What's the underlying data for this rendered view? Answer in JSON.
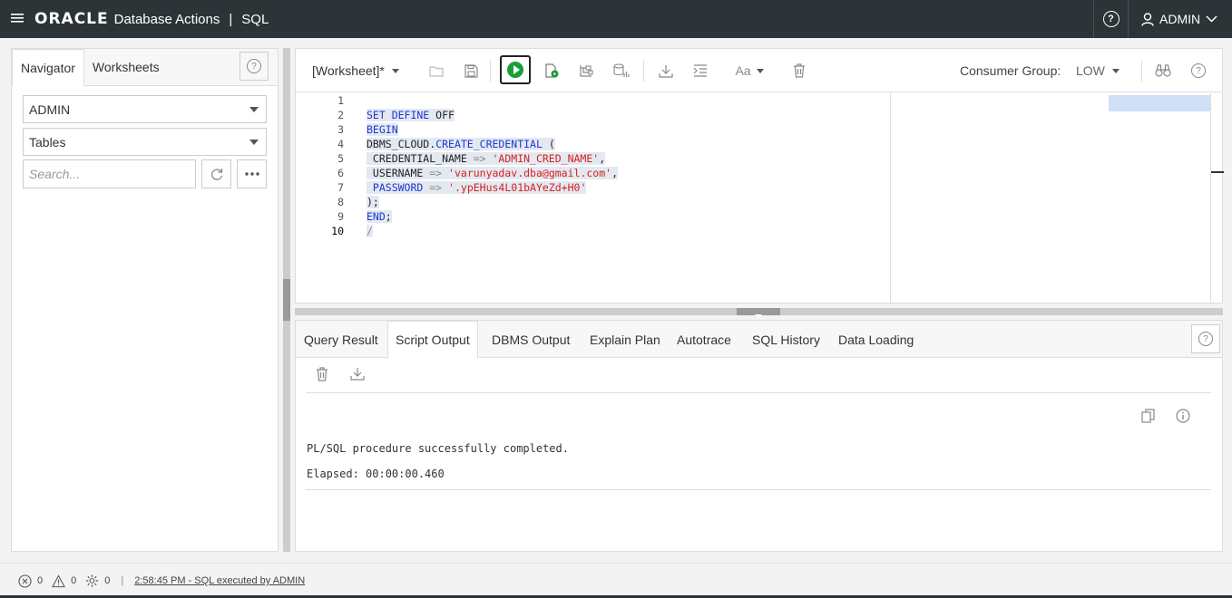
{
  "header": {
    "brand_logo": "ORACLE",
    "product": "Database Actions",
    "separator": "|",
    "section": "SQL",
    "user": "ADMIN"
  },
  "navigator": {
    "tabs": [
      "Navigator",
      "Worksheets"
    ],
    "active_tab": "Navigator",
    "schema_select": "ADMIN",
    "object_type_select": "Tables",
    "search_placeholder": "Search..."
  },
  "toolbar": {
    "worksheet_name": "[Worksheet]*",
    "consumer_group_label": "Consumer Group:",
    "consumer_group_value": "LOW"
  },
  "editor": {
    "line_numbers": [
      "1",
      "2",
      "3",
      "4",
      "5",
      "6",
      "7",
      "8",
      "9",
      "10"
    ],
    "lines": [
      [],
      [
        {
          "t": "SET DEFINE ",
          "c": "kw"
        },
        {
          "t": "OFF",
          "c": "plain"
        }
      ],
      [
        {
          "t": "BEGIN",
          "c": "kw"
        }
      ],
      [
        {
          "t": "DBMS_CLOUD",
          "c": "plain"
        },
        {
          "t": ".",
          "c": "plain"
        },
        {
          "t": "CREATE_CREDENTIAL",
          "c": "kw"
        },
        {
          "t": " (",
          "c": "plain"
        }
      ],
      [
        {
          "t": " CREDENTIAL_NAME ",
          "c": "plain"
        },
        {
          "t": "=>",
          "c": "op"
        },
        {
          "t": " ",
          "c": "plain"
        },
        {
          "t": "'ADMIN_CRED_NAME'",
          "c": "str"
        },
        {
          "t": ",",
          "c": "plain"
        }
      ],
      [
        {
          "t": " USERNAME ",
          "c": "plain"
        },
        {
          "t": "=>",
          "c": "op"
        },
        {
          "t": " ",
          "c": "plain"
        },
        {
          "t": "'varunyadav.dba@gmail.com'",
          "c": "str"
        },
        {
          "t": ",",
          "c": "plain"
        }
      ],
      [
        {
          "t": " PASSWORD ",
          "c": "kw"
        },
        {
          "t": "=>",
          "c": "op"
        },
        {
          "t": " ",
          "c": "plain"
        },
        {
          "t": "'.ypEHus4L01bAYeZd+H0'",
          "c": "str"
        }
      ],
      [
        {
          "t": ");",
          "c": "plain"
        }
      ],
      [
        {
          "t": "END",
          "c": "kw"
        },
        {
          "t": ";",
          "c": "plain"
        }
      ],
      [
        {
          "t": "/",
          "c": "op"
        }
      ]
    ]
  },
  "output": {
    "tabs": [
      "Query Result",
      "Script Output",
      "DBMS Output",
      "Explain Plan",
      "Autotrace",
      "SQL History",
      "Data Loading"
    ],
    "active_tab": "Script Output",
    "message": "PL/SQL procedure successfully completed.",
    "elapsed": "Elapsed: 00:00:00.460"
  },
  "status": {
    "errors": "0",
    "warnings": "0",
    "tasks": "0",
    "separator": "|",
    "last_action": "2:58:45 PM - SQL executed by ADMIN"
  },
  "colors": {
    "header_bg": "#2d3437",
    "run_green": "#1a9d3a",
    "keyword": "#1f36d4",
    "string": "#d81e1e"
  }
}
